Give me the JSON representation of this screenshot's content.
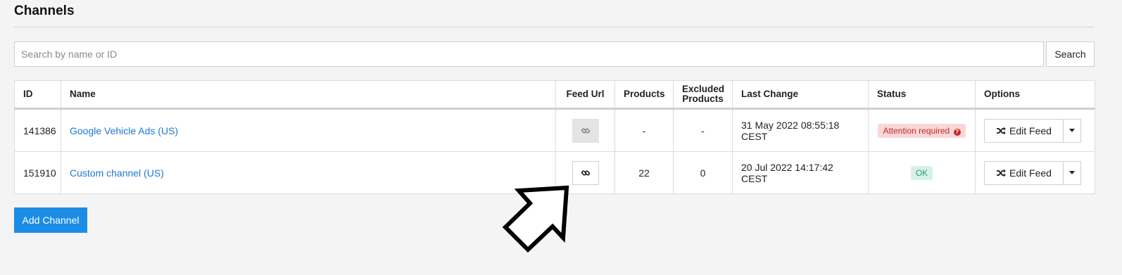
{
  "page": {
    "title": "Channels"
  },
  "search": {
    "placeholder": "Search by name or ID",
    "value": "",
    "button_label": "Search"
  },
  "table": {
    "headers": {
      "id": "ID",
      "name": "Name",
      "feed_url": "Feed Url",
      "products": "Products",
      "excluded_line1": "Excluded",
      "excluded_line2": "Products",
      "last_change": "Last Change",
      "status": "Status",
      "options": "Options"
    },
    "rows": [
      {
        "id": "141386",
        "name": "Google Vehicle Ads (US)",
        "feed_url_enabled": false,
        "products": "-",
        "excluded": "-",
        "last_change": "31 May 2022 08:55:18 CEST",
        "status": "Attention required",
        "status_type": "attention",
        "edit_label": "Edit Feed"
      },
      {
        "id": "151910",
        "name": "Custom channel (US)",
        "feed_url_enabled": true,
        "products": "22",
        "excluded": "0",
        "last_change": "20 Jul 2022 14:17:42 CEST",
        "status": "OK",
        "status_type": "ok",
        "edit_label": "Edit Feed"
      }
    ]
  },
  "actions": {
    "add_channel_label": "Add Channel"
  },
  "colors": {
    "link": "#1d77d3",
    "primary": "#1b8de6",
    "attention_bg": "#f9d7d7",
    "attention_text": "#c3282b",
    "ok_bg": "#d5f2ea",
    "ok_text": "#2c9a7a"
  },
  "icons": {
    "feed_url": "link-icon",
    "edit": "shuffle-icon",
    "dropdown": "caret-down-icon",
    "help": "question-circle-icon",
    "annotation": "arrow-pointer-icon"
  }
}
